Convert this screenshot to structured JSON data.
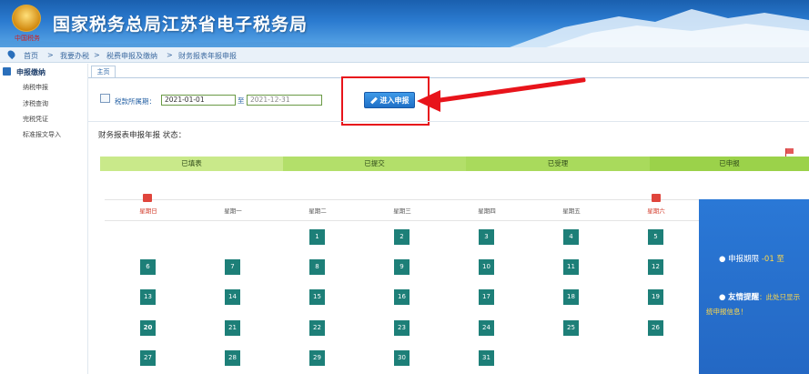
{
  "header": {
    "site_title": "国家税务总局江苏省电子税务局",
    "emblem_caption": "中国税务"
  },
  "breadcrumb": {
    "items": [
      "首页",
      "我要办税",
      "税费申报及缴纳",
      "财务报表年报申报"
    ],
    "separator": ">"
  },
  "sidebar": {
    "section_title": "申报缴纳",
    "items": [
      "纳税申报",
      "涉税查询",
      "完税凭证",
      "标准报文导入"
    ]
  },
  "tabs": [
    {
      "label": "主页"
    }
  ],
  "period": {
    "label": "税款所属期：",
    "start": "2021-01-01",
    "to_label": "至",
    "end": "2021-12-31"
  },
  "enter_button": {
    "label": "进入申报"
  },
  "status_title": "财务报表申报年报 状态：",
  "steps": [
    {
      "label": "已填表",
      "color": "#c9e98a"
    },
    {
      "label": "已提交",
      "color": "#b3df6a"
    },
    {
      "label": "已受理",
      "color": "#a9da5c"
    },
    {
      "label": "已申报",
      "color": "#9bd24a"
    }
  ],
  "calendar": {
    "weekdays": [
      "星期日",
      "星期一",
      "星期二",
      "星期三",
      "星期四",
      "星期五",
      "星期六"
    ],
    "weeks": [
      [
        null,
        null,
        "1",
        "2",
        "3",
        "4",
        "5"
      ],
      [
        "6",
        "7",
        "8",
        "9",
        "10",
        "11",
        "12"
      ],
      [
        "13",
        "14",
        "15",
        "16",
        "17",
        "18",
        "19"
      ],
      [
        "20",
        "21",
        "22",
        "23",
        "24",
        "25",
        "26"
      ],
      [
        "27",
        "28",
        "29",
        "30",
        "31",
        null,
        null
      ]
    ],
    "highlight_color": "#1d7f78"
  },
  "info_panel": {
    "deadline_label": "申报期限",
    "deadline_value": "-01 至",
    "reminder_label": "友情提醒",
    "reminder_text": "：此处只显示",
    "reminder_text2": "统申报信息！"
  }
}
